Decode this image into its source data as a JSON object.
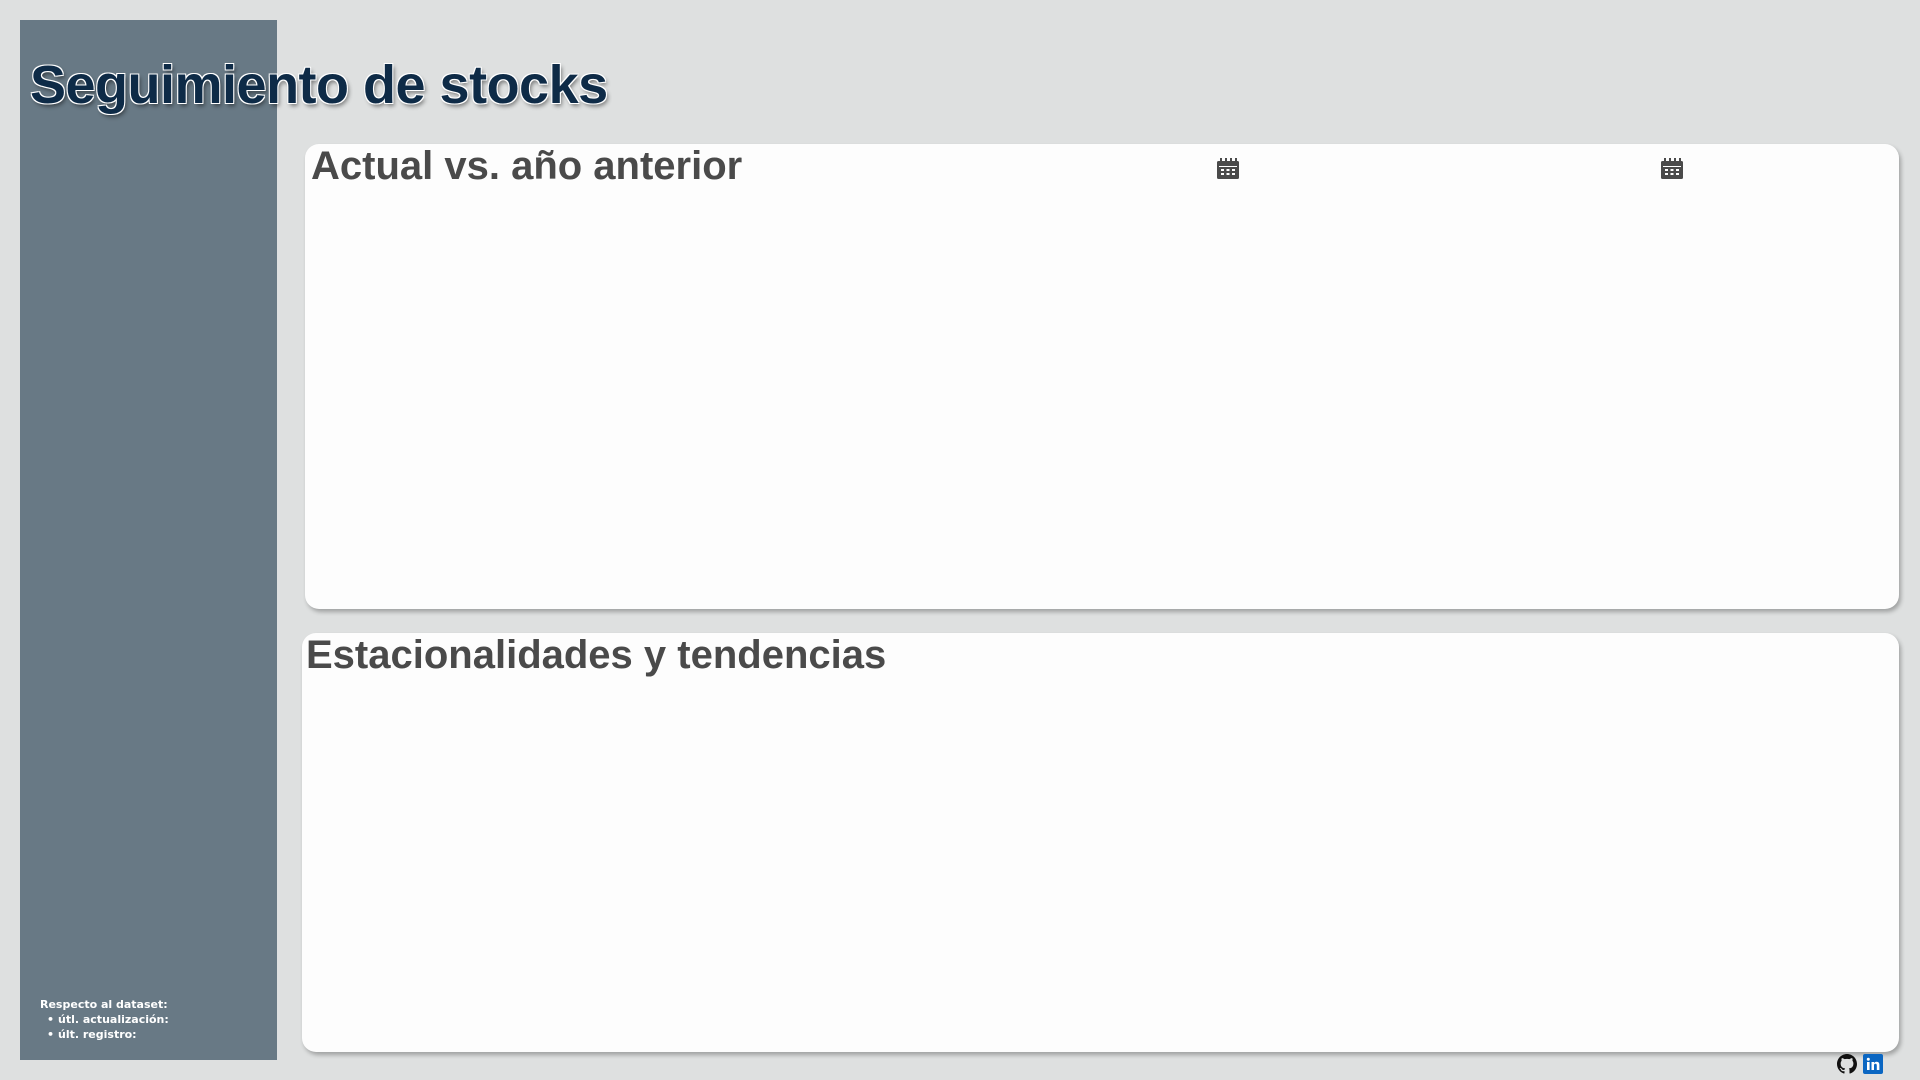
{
  "header": {
    "title": "Seguimiento de stocks"
  },
  "sidebar": {
    "dataset_heading": "Respecto al dataset:",
    "dataset_items": [
      "útl. actualización:",
      "últ. registro:"
    ],
    "background_color": "#687985"
  },
  "sections": {
    "current_vs_previous": {
      "title": "Actual vs. año anterior",
      "date_pickers": [
        {
          "icon": "calendar-icon"
        },
        {
          "icon": "calendar-icon"
        }
      ]
    },
    "seasonality": {
      "title": "Estacionalidades y tendencias"
    }
  },
  "footer": {
    "links": [
      {
        "icon": "github-icon"
      },
      {
        "icon": "linkedin-icon",
        "color": "#0a66c2"
      }
    ]
  },
  "colors": {
    "title": "#0e2b47",
    "card_title": "#4a4a4a",
    "background": "#dee0e0"
  }
}
